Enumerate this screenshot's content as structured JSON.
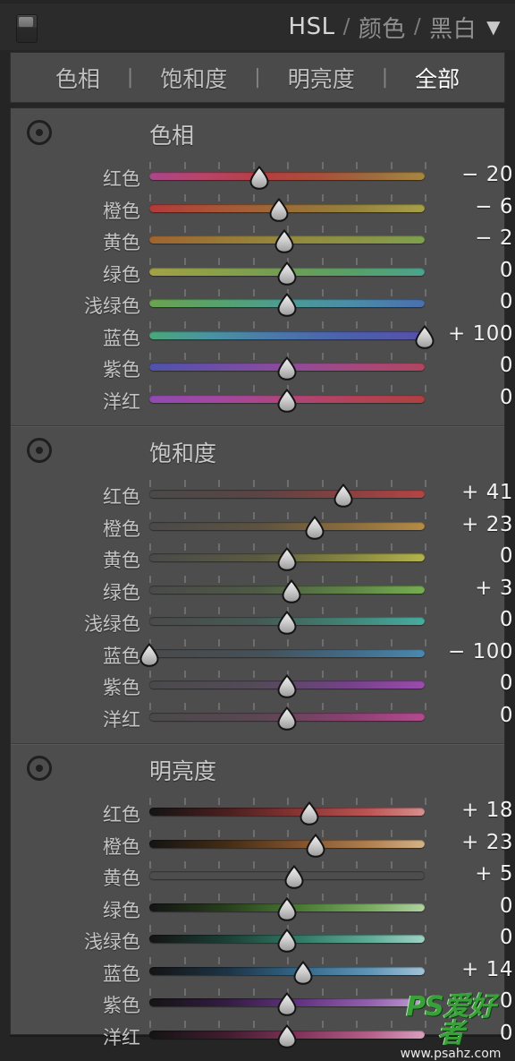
{
  "header": {
    "power_switch": "panel-toggle",
    "title_primary": "HSL",
    "separator": "/",
    "title_second": "颜色",
    "title_third": "黑白",
    "caret": "▼"
  },
  "tabs": [
    {
      "label": "色相",
      "active": false
    },
    {
      "label": "饱和度",
      "active": false
    },
    {
      "label": "明亮度",
      "active": false
    },
    {
      "label": "全部",
      "active": true
    }
  ],
  "tab_separator": "|",
  "colors": {
    "panel_bg": "#4d4d4d",
    "header_bg": "#2b2b2b",
    "tabbar_bg": "#4a4a4a",
    "outer_bg": "#252525",
    "label_text": "#c4c4c4",
    "value_text": "#f2f2f2",
    "active_tab": "#ffffff"
  },
  "sections": [
    {
      "id": "hue",
      "title": "色相",
      "target_icon": "target-adjust-icon",
      "rows": [
        {
          "label": "红色",
          "value": "− 20",
          "pos": 40.0,
          "grad": "linear-gradient(90deg,#a8478a 0%,#b8446b 18%,#b53f40 42%,#a8503a 62%,#9d6a3f 80%,#a8873f 100%)"
        },
        {
          "label": "橙色",
          "value": "− 6",
          "pos": 47.0,
          "grad": "linear-gradient(90deg,#b23a3a 0%,#ab5236 22%,#9c6b36 48%,#95803c 72%,#a6a049 100%)"
        },
        {
          "label": "黄色",
          "value": "− 2",
          "pos": 49.0,
          "grad": "linear-gradient(90deg,#a0642f 0%,#9a7835 25%,#94893c 50%,#8d9243 72%,#7fa04c 100%)"
        },
        {
          "label": "绿色",
          "value": "0",
          "pos": 50.0,
          "grad": "linear-gradient(90deg,#a3a144 0%,#8ea047 22%,#6f9e55 50%,#56a169 75%,#4aa391 100%)"
        },
        {
          "label": "浅绿色",
          "value": "0",
          "pos": 50.0,
          "grad": "linear-gradient(90deg,#6ba350 0%,#55a272 28%,#4b9b97 52%,#4b8ba8 75%,#4a6fae 100%)"
        },
        {
          "label": "蓝色",
          "value": "+ 100",
          "pos": 100.0,
          "grad": "linear-gradient(90deg,#4aa87a 0%,#4a93a2 22%,#4a76ab 48%,#4c60ad 72%,#5750a8 100%)"
        },
        {
          "label": "紫色",
          "value": "0",
          "pos": 50.0,
          "grad": "linear-gradient(90deg,#4e53ab 0%,#6a4ea8 22%,#8c4b9e 48%,#a6487f 74%,#b2455f 100%)"
        },
        {
          "label": "洋红",
          "value": "0",
          "pos": 50.0,
          "grad": "linear-gradient(90deg,#8f4ab2 0%,#a347a0 25%,#b04477 52%,#b34255 76%,#ae4040 100%)"
        }
      ]
    },
    {
      "id": "saturation",
      "title": "饱和度",
      "target_icon": "target-adjust-icon",
      "rows": [
        {
          "label": "红色",
          "value": "+ 41",
          "pos": 70.5,
          "grad": "linear-gradient(90deg,#4a4a4a 0%,#5a4444 40%,#8a4040 72%,#b54444 100%)"
        },
        {
          "label": "橙色",
          "value": "+ 23",
          "pos": 60.0,
          "grad": "linear-gradient(90deg,#4a4a4a 0%,#5c5240 40%,#8a6c3c 72%,#b58c44 100%)"
        },
        {
          "label": "黄色",
          "value": "0",
          "pos": 50.0,
          "grad": "linear-gradient(90deg,#4a4a4a 0%,#5a5a42 40%,#868641 72%,#b3b34c 100%)"
        },
        {
          "label": "绿色",
          "value": "+ 3",
          "pos": 51.5,
          "grad": "linear-gradient(90deg,#4a4a4a 0%,#4e5a45 40%,#5f8446 72%,#76ad52 100%)"
        },
        {
          "label": "浅绿色",
          "value": "0",
          "pos": 50.0,
          "grad": "linear-gradient(90deg,#4a4a4a 0%,#455a54 40%,#418477 72%,#46ada0 100%)"
        },
        {
          "label": "蓝色",
          "value": "− 100",
          "pos": 0.0,
          "grad": "linear-gradient(90deg,#4a4a4a 0%,#455058 40%,#426a86 72%,#4a88b0 100%)"
        },
        {
          "label": "紫色",
          "value": "0",
          "pos": 50.0,
          "grad": "linear-gradient(90deg,#4a4a4a 0%,#544a5a 40%,#744287 72%,#9a4cae 100%)"
        },
        {
          "label": "洋红",
          "value": "0",
          "pos": 50.0,
          "grad": "linear-gradient(90deg,#4a4a4a 0%,#5a4752 40%,#8a4070 72%,#b34a8e 100%)"
        }
      ]
    },
    {
      "id": "luminance",
      "title": "明亮度",
      "target_icon": "target-adjust-icon",
      "rows": [
        {
          "label": "红色",
          "value": "+ 18",
          "pos": 58.0,
          "grad": "linear-gradient(90deg,#141414 0%,#4a1f1f 28%,#8c3636 56%,#bd5656 80%,#d69090 100%)"
        },
        {
          "label": "橙色",
          "value": "+ 23",
          "pos": 60.5,
          "grad": "linear-gradient(90deg,#141414 0%,#432c16 28%,#835530 56%,#b08050 80%,#d4b389 100%)"
        },
        {
          "label": "黄色",
          "value": "+ 5",
          "pos": 52.5,
          "grad": "linear-gradient(90deg,#141414 0%,#3e3c18 28%,#7c7732 56%,#aba45e 80%,#d2ceа0 100%)"
        },
        {
          "label": "绿色",
          "value": "0",
          "pos": 50.0,
          "grad": "linear-gradient(90deg,#141414 0%,#27401b 28%,#4c7c35 56%,#79ab60 80%,#b0d2a0 100%)"
        },
        {
          "label": "浅绿色",
          "value": "0",
          "pos": 50.0,
          "grad": "linear-gradient(90deg,#141414 0%,#1c3f35 28%,#347c68 56%,#5fab96 80%,#a0d2c4 100%)"
        },
        {
          "label": "蓝色",
          "value": "+ 14",
          "pos": 56.0,
          "grad": "linear-gradient(90deg,#141414 0%,#1d3345 28%,#356a8c 56%,#5f95b5 80%,#a3c3d8 100%)"
        },
        {
          "label": "紫色",
          "value": "0",
          "pos": 50.0,
          "grad": "linear-gradient(90deg,#141414 0%,#331c42 28%,#663585 56%,#9360ad 80%,#c0a0d2 100%)"
        },
        {
          "label": "洋红",
          "value": "0",
          "pos": 50.0,
          "grad": "linear-gradient(90deg,#141414 0%,#421c2f 28%,#86355e 56%,#b55f89 80%,#d8a0bd 100%)"
        }
      ]
    }
  ],
  "watermark": {
    "main": "PS爱好者",
    "sub": "www.psahz.com"
  }
}
